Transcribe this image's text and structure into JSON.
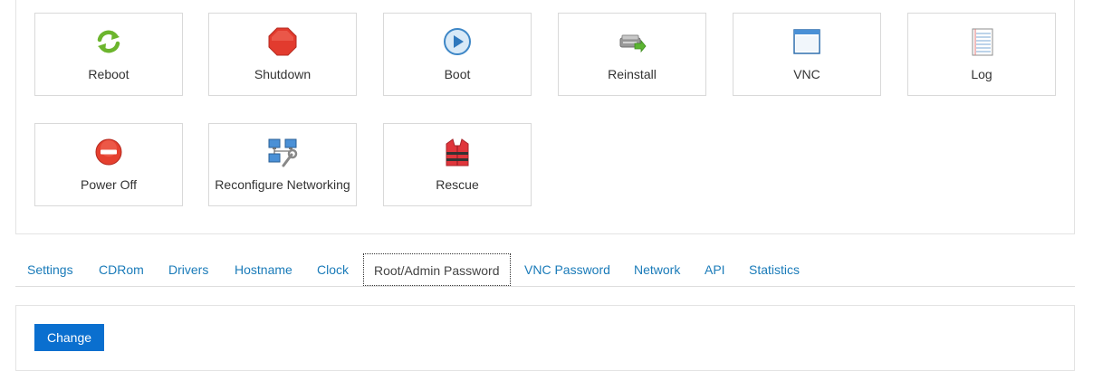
{
  "actions": [
    {
      "label": "Reboot",
      "icon": "reboot-icon"
    },
    {
      "label": "Shutdown",
      "icon": "shutdown-icon"
    },
    {
      "label": "Boot",
      "icon": "boot-icon"
    },
    {
      "label": "Reinstall",
      "icon": "reinstall-icon"
    },
    {
      "label": "VNC",
      "icon": "vnc-window-icon"
    },
    {
      "label": "Log",
      "icon": "log-notepad-icon"
    },
    {
      "label": "Power Off",
      "icon": "power-off-icon"
    },
    {
      "label": "Reconfigure Networking",
      "icon": "network-computers-icon"
    },
    {
      "label": "Rescue",
      "icon": "life-vest-icon"
    }
  ],
  "tabs": [
    {
      "label": "Settings"
    },
    {
      "label": "CDRom"
    },
    {
      "label": "Drivers"
    },
    {
      "label": "Hostname"
    },
    {
      "label": "Clock"
    },
    {
      "label": "Root/Admin Password",
      "active": true
    },
    {
      "label": "VNC Password"
    },
    {
      "label": "Network"
    },
    {
      "label": "API"
    },
    {
      "label": "Statistics"
    }
  ],
  "content": {
    "change_label": "Change"
  },
  "colors": {
    "link": "#1a7bb9",
    "button": "#0a6fcf",
    "border": "#d9d9d9"
  }
}
